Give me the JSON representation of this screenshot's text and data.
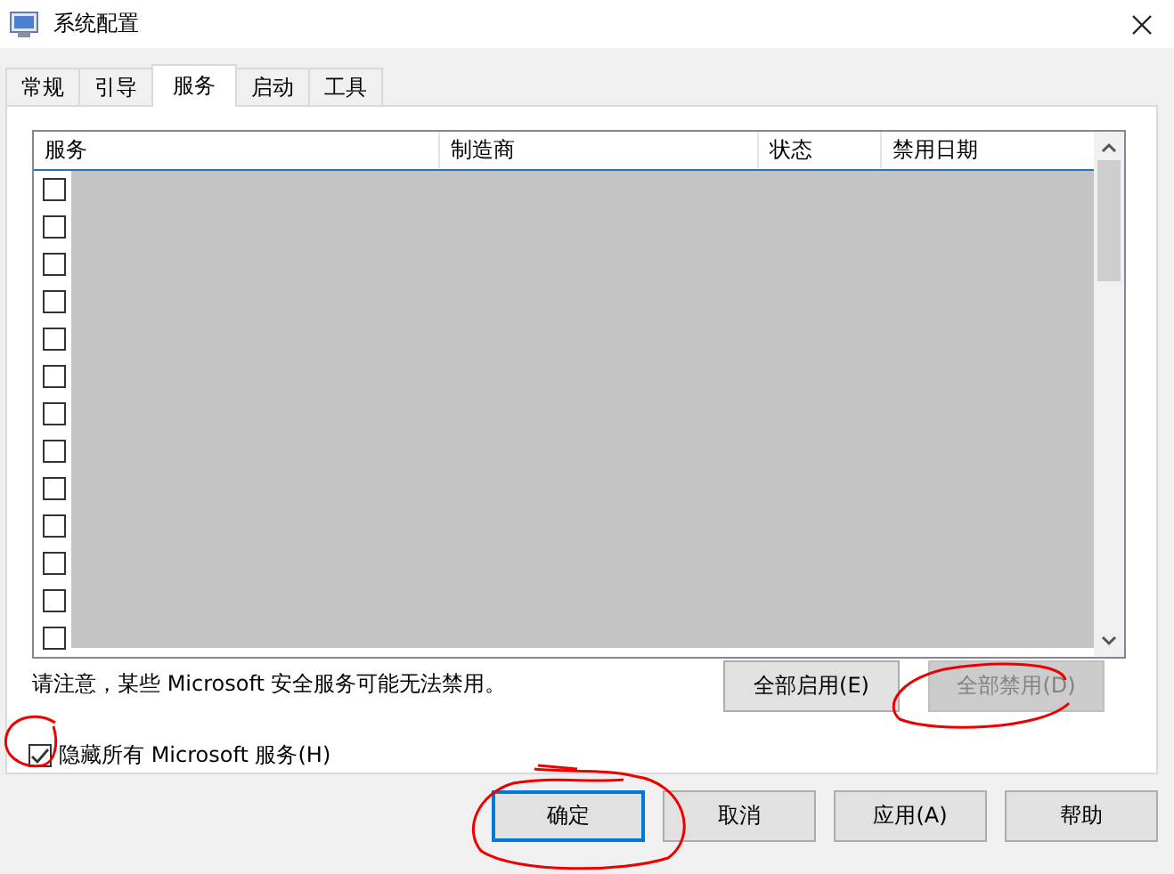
{
  "window": {
    "title": "系统配置"
  },
  "tabs": [
    {
      "label": "常规",
      "selected": false
    },
    {
      "label": "引导",
      "selected": false
    },
    {
      "label": "服务",
      "selected": true
    },
    {
      "label": "启动",
      "selected": false
    },
    {
      "label": "工具",
      "selected": false
    }
  ],
  "services_table": {
    "columns": [
      "服务",
      "制造商",
      "状态",
      "禁用日期"
    ],
    "rows": [
      {
        "checked": false
      },
      {
        "checked": false
      },
      {
        "checked": false
      },
      {
        "checked": false
      },
      {
        "checked": false
      },
      {
        "checked": false
      },
      {
        "checked": false
      },
      {
        "checked": false
      },
      {
        "checked": false
      },
      {
        "checked": false
      },
      {
        "checked": false
      },
      {
        "checked": false
      },
      {
        "checked": false
      }
    ]
  },
  "note": "请注意，某些 Microsoft 安全服务可能无法禁用。",
  "list_buttons": [
    {
      "label": "全部启用(E)",
      "disabled": false
    },
    {
      "label": "全部禁用(D)",
      "disabled": true
    }
  ],
  "hide_microsoft": {
    "label": "隐藏所有 Microsoft 服务(H)",
    "checked": true
  },
  "dialog_buttons": [
    {
      "label": "确定",
      "default": true
    },
    {
      "label": "取消",
      "default": false
    },
    {
      "label": "应用(A)",
      "default": false
    },
    {
      "label": "帮助",
      "default": false
    }
  ]
}
